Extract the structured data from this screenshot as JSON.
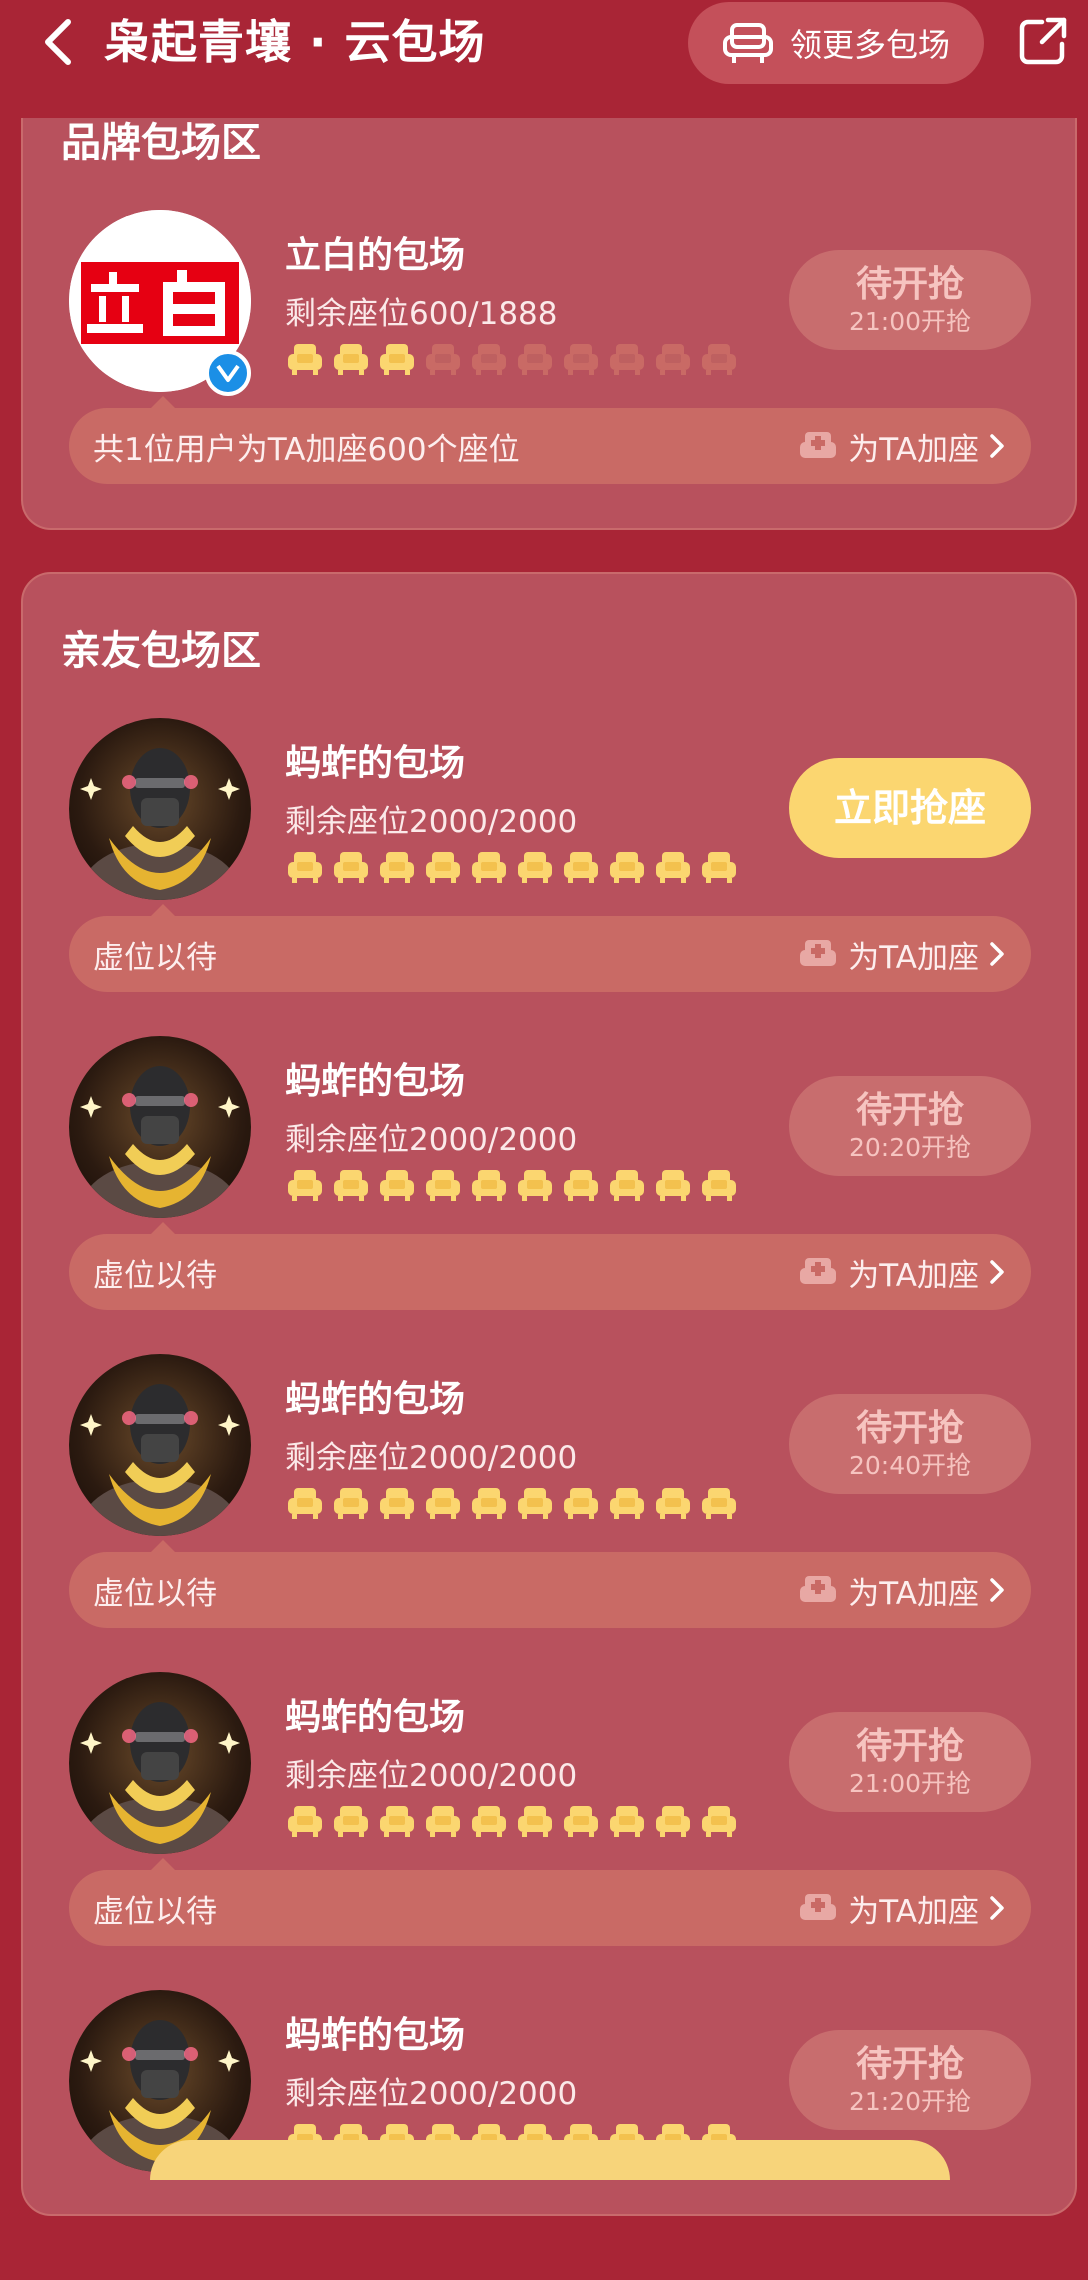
{
  "header": {
    "title": "枭起青壤 · 云包场",
    "more_button": "领更多包场"
  },
  "brand_section": {
    "title": "品牌包场区",
    "card": {
      "avatar_text": "立白",
      "name": "立白的包场",
      "seats_text": "剩余座位600/1888",
      "seats_filled": 3,
      "seats_total": 10,
      "action_main": "待开抢",
      "action_sub": "21:00开抢",
      "bar_text": "共1位用户为TA加座600个座位",
      "add_label": "为TA加座"
    }
  },
  "friend_section": {
    "title": "亲友包场区",
    "cards": [
      {
        "name": "蚂蚱的包场",
        "seats_text": "剩余座位2000/2000",
        "action_main": "立即抢座",
        "action_sub": "",
        "active": true,
        "bar_text": "虚位以待",
        "add_label": "为TA加座"
      },
      {
        "name": "蚂蚱的包场",
        "seats_text": "剩余座位2000/2000",
        "action_main": "待开抢",
        "action_sub": "20:20开抢",
        "active": false,
        "bar_text": "虚位以待",
        "add_label": "为TA加座"
      },
      {
        "name": "蚂蚱的包场",
        "seats_text": "剩余座位2000/2000",
        "action_main": "待开抢",
        "action_sub": "20:40开抢",
        "active": false,
        "bar_text": "虚位以待",
        "add_label": "为TA加座"
      },
      {
        "name": "蚂蚱的包场",
        "seats_text": "剩余座位2000/2000",
        "action_main": "待开抢",
        "action_sub": "21:00开抢",
        "active": false,
        "bar_text": "虚位以待",
        "add_label": "为TA加座"
      },
      {
        "name": "蚂蚱的包场",
        "seats_text": "剩余座位2000/2000",
        "action_main": "待开抢",
        "action_sub": "21:20开抢",
        "active": false,
        "bar_text": "",
        "add_label": ""
      }
    ]
  },
  "colors": {
    "background": "#a92536",
    "panel": "#b8515d",
    "bar": "#c96a65",
    "active_button": "#fbd670",
    "seat_filled": "#fbd670",
    "seat_empty": "#c96a65"
  },
  "icons": {
    "back": "chevron-left-icon",
    "sofa": "sofa-icon",
    "share": "share-icon",
    "verified": "verified-icon"
  }
}
